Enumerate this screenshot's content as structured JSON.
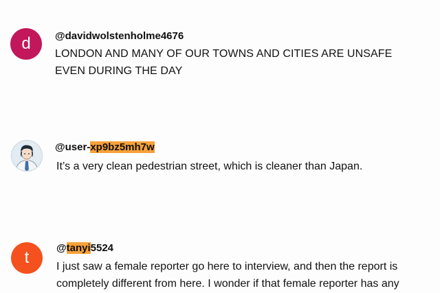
{
  "comments": [
    {
      "avatar_letter": "d",
      "avatar_color": "#c2185b",
      "handle": "@davidwolstenholme4676",
      "lines": [
        "LONDON AND MANY OF OUR TOWNS AND CITIES ARE UNSAFE",
        "EVEN DURING THE DAY"
      ]
    },
    {
      "avatar_icon": "user-photo-avatar",
      "handle_prefix": "@user-",
      "handle_highlight": "xp9bz5mh7w",
      "lines": [
        "It’s a very clean pedestrian street, which is cleaner than Japan."
      ]
    },
    {
      "avatar_letter": "t",
      "avatar_color": "#f4511e",
      "handle_prefix": "@",
      "handle_highlight": "tanyi",
      "handle_suffix": "5524",
      "lines": [
        "I just saw a female reporter go here to interview, and then the report is",
        "completely different from here. I wonder if that female reporter has any"
      ]
    }
  ],
  "highlight_color": "#f7a13a"
}
